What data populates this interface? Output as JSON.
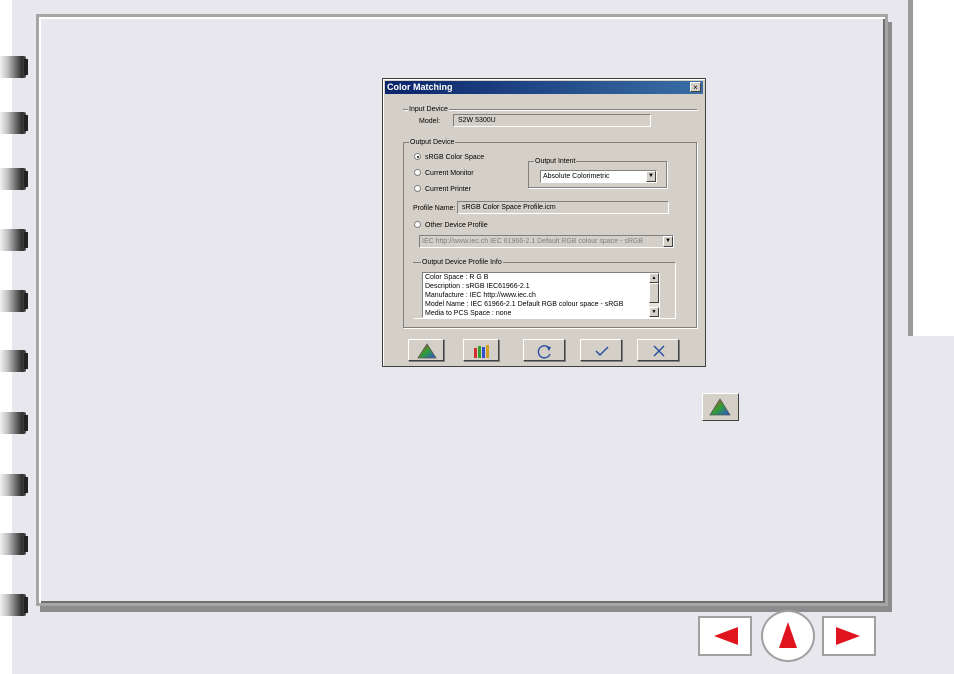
{
  "dialog": {
    "title": "Color Matching",
    "close_label": "×",
    "input_device": {
      "group_label": "Input Device",
      "model_label": "Model:",
      "model_value": "S2W 5300U"
    },
    "output_device": {
      "group_label": "Output Device",
      "options": {
        "srgb": "sRGB Color Space",
        "monitor": "Current Monitor",
        "printer": "Current Printer",
        "other": "Other Device Profile"
      },
      "selected_option": "sRGB Color Space",
      "output_intent": {
        "group_label": "Output Intent",
        "selected": "Absolute Colorimetric",
        "arrow": "▼"
      },
      "profile_name_label": "Profile Name:",
      "profile_name_value": "sRGB Color Space Profile.icm",
      "other_profile_select": "IEC http://www.iec.ch IEC 61966-2.1 Default RGB colour space - sRGB",
      "profile_info": {
        "group_label": "Output Device Profile Info",
        "lines": [
          "Color Space : R G B",
          "Description : sRGB IEC61966-2.1",
          "Manufacture : IEC http://www.iec.ch",
          "Model Name : IEC 61966-2.1 Default RGB colour space - sRGB",
          "Media to PCS Space : none"
        ],
        "scroll_up": "▲",
        "scroll_down": "▼"
      }
    },
    "buttons": {
      "color_icon": "color-triangle-icon",
      "calibration_icon": "color-bars-icon",
      "reset_icon": "refresh-icon",
      "ok_icon": "checkmark-icon",
      "cancel_icon": "x-mark-icon"
    }
  },
  "navigation": {
    "prev_icon": "left-arrow-icon",
    "up_icon": "up-arrow-icon",
    "next_icon": "right-arrow-icon",
    "arrow_color": "#e0141e"
  }
}
